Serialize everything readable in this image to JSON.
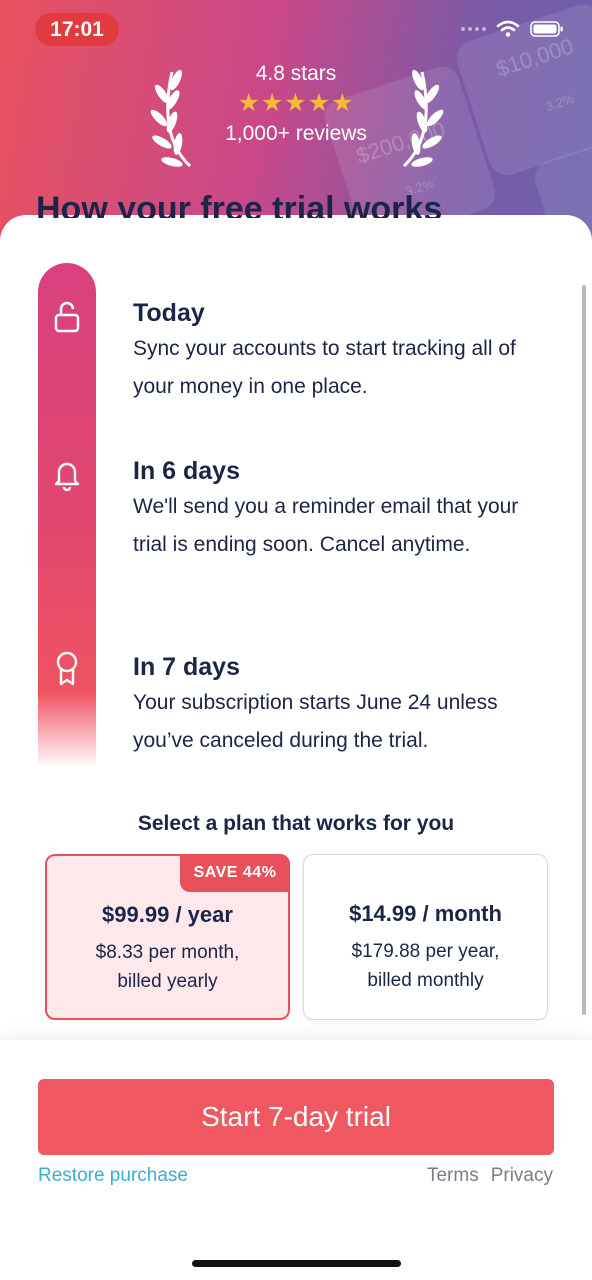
{
  "status_bar": {
    "time": "17:01"
  },
  "rating": {
    "stars_text": "4.8 stars",
    "stars": "★★★★★",
    "reviews": "1,000+ reviews"
  },
  "background": {
    "ghost_amount_1": "$10,000",
    "ghost_amount_2": "$200,000",
    "ghost_pct_1": "3.2%",
    "ghost_pct_2": "3.2%"
  },
  "sheet": {
    "title": "How your free trial works",
    "steps": [
      {
        "title": "Today",
        "desc": "Sync your accounts to start tracking all of your money in one place.",
        "icon": "unlock-icon"
      },
      {
        "title": "In 6 days",
        "desc": "We'll send you a reminder email that your trial is ending soon. Cancel anytime.",
        "icon": "bell-icon"
      },
      {
        "title": "In 7 days",
        "desc": "Your subscription starts June 24 unless you’ve canceled during the trial.",
        "icon": "award-icon"
      }
    ]
  },
  "plans": {
    "heading": "Select a plan that works for you",
    "yearly": {
      "badge": "SAVE 44%",
      "price": "$99.99 / year",
      "line1": "$8.33 per month,",
      "line2": "billed yearly"
    },
    "monthly": {
      "price": "$14.99 / month",
      "line1": "$179.88 per year,",
      "line2": "billed monthly"
    }
  },
  "footer": {
    "cta": "Start 7-day trial",
    "restore": "Restore purchase",
    "terms": "Terms",
    "privacy": "Privacy"
  },
  "colors": {
    "accent": "#ef5761",
    "link": "#3aaed2",
    "navy": "#1c2548",
    "star": "#f8b83a"
  }
}
